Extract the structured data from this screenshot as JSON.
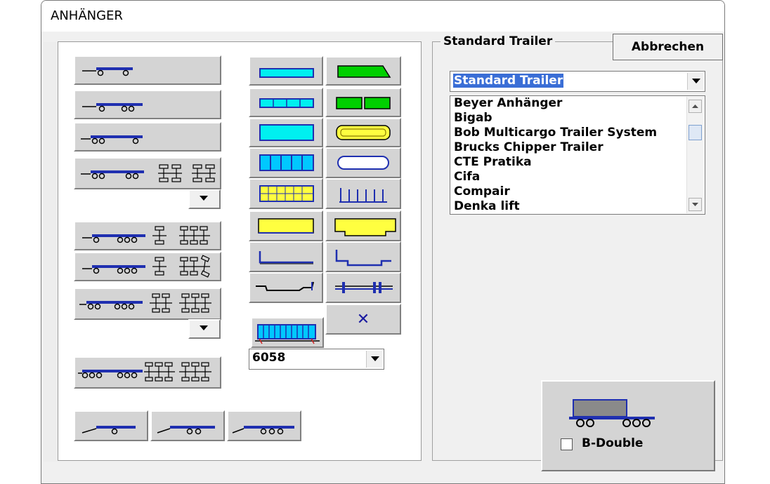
{
  "window": {
    "title": "ANHÄNGER"
  },
  "group": {
    "label": "Standard Trailer",
    "cancel_label": "Abbrechen"
  },
  "manufacturer_select": {
    "selected": "Standard Trailer"
  },
  "manufacturer_list": {
    "items": [
      "Beyer Anhänger",
      "Bigab",
      "Bob Multicargo Trailer System",
      "Brucks Chipper Trailer",
      "CTE Pratika",
      "Cifa",
      "Compair",
      "Denka lift"
    ]
  },
  "body_type_select": {
    "value": "6058"
  },
  "b_double": {
    "label": "B-Double",
    "checked": false
  },
  "body_buttons": {
    "none_glyph": "✕"
  },
  "colors": {
    "accent_blue": "#1f2fb0",
    "cyan": "#00f0f0",
    "green": "#00d000",
    "yellow": "#ffff40",
    "button_face": "#d4d4d4"
  }
}
